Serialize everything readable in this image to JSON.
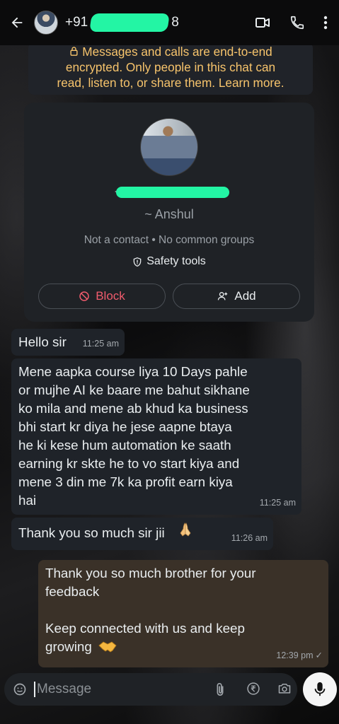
{
  "header": {
    "phone_prefix": "+91",
    "phone_suffix": "8"
  },
  "encryption_notice": {
    "line1": "Messages and calls are end-to-end",
    "line2": "encrypted. Only people in this chat can",
    "line3": "read, listen to, or share them. Learn more."
  },
  "contact_card": {
    "number_prefix": "+",
    "name": "~ Anshul",
    "meta": "Not a contact • No common groups",
    "safety_label": "Safety tools",
    "block_label": "Block",
    "add_label": "Add"
  },
  "messages": [
    {
      "text": "Hello sir",
      "time": "11:25 am"
    },
    {
      "lines": [
        "Mene aapka course liya 10 Days pahle",
        "or mujhe AI ke baare me bahut sikhane",
        "ko mila and mene ab khud ka business",
        "bhi start kr diya he jese aapne btaya",
        "he ki kese hum automation ke saath",
        "earning kr skte he to vo start kiya and",
        "mene 3 din me 7k ka profit earn kiya",
        "hai"
      ],
      "time": "11:25 am"
    },
    {
      "text": "Thank you so much sir jii",
      "time": "11:26 am"
    },
    {
      "lines": [
        "Thank you so much brother for your",
        "feedback",
        "",
        "Keep connected with us and keep",
        "growing"
      ],
      "time": "12:39 pm"
    }
  ],
  "composer": {
    "placeholder": "Message"
  },
  "colors": {
    "incoming_bubble": "#1f2329",
    "outgoing_bubble": "#3a3128",
    "encryption_text": "#f7c46c",
    "block_red": "#f15c6d",
    "redaction_green": "#23f5a4"
  }
}
